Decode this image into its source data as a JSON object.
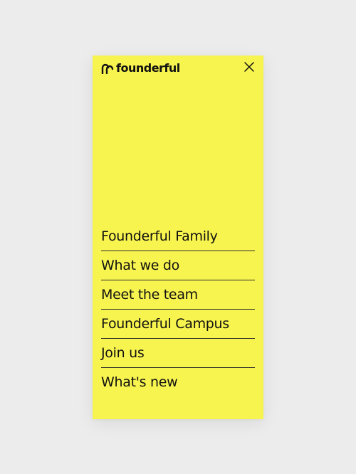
{
  "brand": {
    "name": "founderful",
    "logo_icon": "founderful-logo-icon"
  },
  "header": {
    "close_icon": "close-icon"
  },
  "menu": {
    "items": [
      {
        "label": "Founderful Family"
      },
      {
        "label": "What we do"
      },
      {
        "label": "Meet the team"
      },
      {
        "label": "Founderful Campus"
      },
      {
        "label": "Join us"
      },
      {
        "label": "What's new"
      }
    ]
  },
  "colors": {
    "panel_background": "#f8f44f",
    "page_background": "#ececec",
    "text": "#111111"
  }
}
